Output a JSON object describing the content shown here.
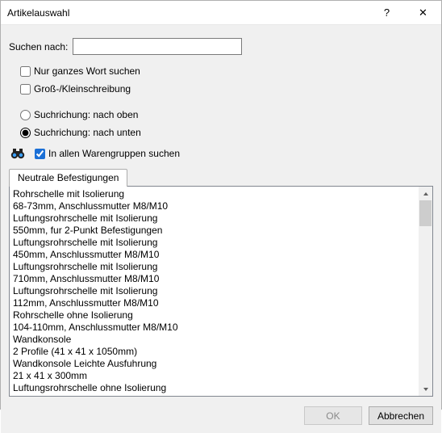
{
  "window": {
    "title": "Artikelauswahl"
  },
  "search": {
    "label": "Suchen nach:",
    "value": ""
  },
  "options": {
    "whole_word": {
      "label": "Nur ganzes Wort suchen",
      "checked": false
    },
    "case_sensitive": {
      "label": "Groß-/Kleinschreibung",
      "checked": false
    },
    "dir_up": {
      "label": "Suchrichung: nach oben",
      "selected": false
    },
    "dir_down": {
      "label": "Suchrichung: nach unten",
      "selected": true
    }
  },
  "all_groups": {
    "label": "In allen Warengruppen suchen",
    "checked": true
  },
  "tab": {
    "label": "Neutrale Befestigungen"
  },
  "items": [
    {
      "l1": "Rohrschelle mit Isolierung",
      "l2": "68-73mm, Anschlussmutter M8/M10"
    },
    {
      "l1": "Luftungsrohrschelle mit Isolierung",
      "l2": "550mm, fur 2-Punkt Befestigungen"
    },
    {
      "l1": "Luftungsrohrschelle mit Isolierung",
      "l2": "450mm, Anschlussmutter M8/M10"
    },
    {
      "l1": "Luftungsrohrschelle mit Isolierung",
      "l2": "710mm, Anschlussmutter M8/M10"
    },
    {
      "l1": "Luftungsrohrschelle mit Isolierung",
      "l2": "112mm, Anschlussmutter M8/M10"
    },
    {
      "l1": "Rohrschelle ohne Isolierung",
      "l2": "104-110mm, Anschlussmutter M8/M10"
    },
    {
      "l1": "Wandkonsole",
      "l2": "2 Profile (41 x 41 x 1050mm)"
    },
    {
      "l1": "Wandkonsole Leichte Ausfuhrung",
      "l2": "21 x 41 x 300mm"
    },
    {
      "l1": "Luftungsrohrschelle ohne Isolierung"
    }
  ],
  "buttons": {
    "ok": "OK",
    "cancel": "Abbrechen"
  }
}
